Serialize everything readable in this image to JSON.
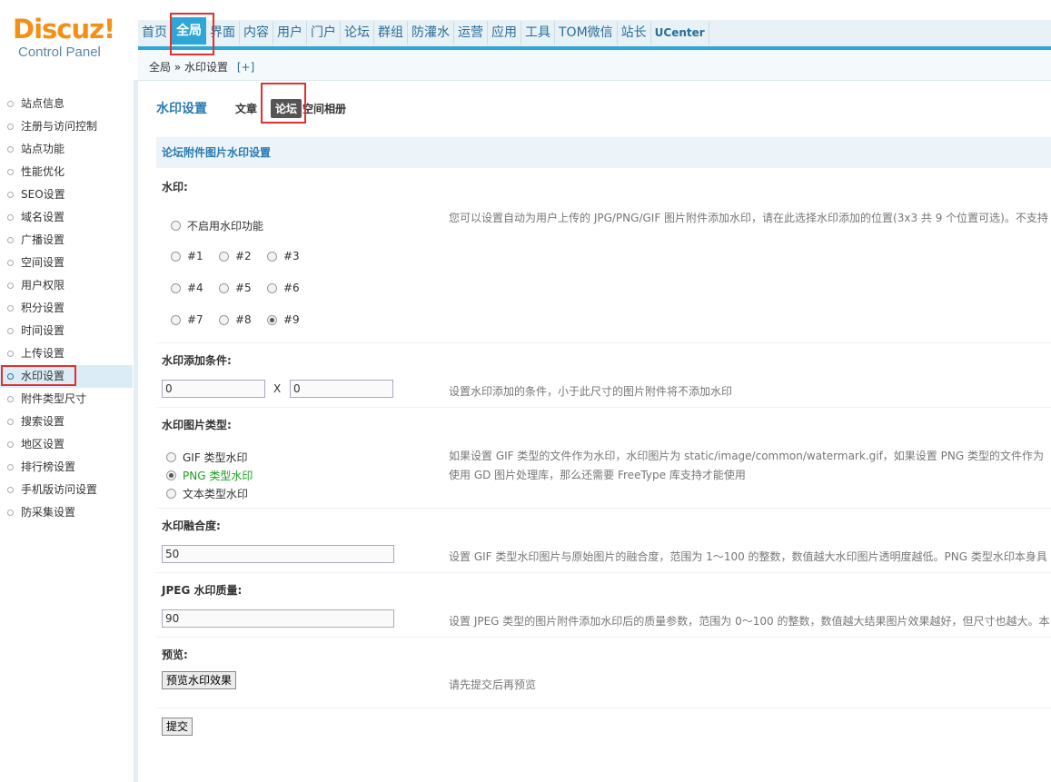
{
  "logo": {
    "brand": "Discuz!",
    "sub": "Control Panel"
  },
  "topnav": [
    "首页",
    "全局",
    "界面",
    "内容",
    "用户",
    "门户",
    "论坛",
    "群组",
    "防灌水",
    "运营",
    "应用",
    "工具",
    "TOM微信",
    "站长",
    "UCenter"
  ],
  "breadcrumb": {
    "path": "全局 » 水印设置",
    "plus": "[+]"
  },
  "sidebar": [
    "站点信息",
    "注册与访问控制",
    "站点功能",
    "性能优化",
    "SEO设置",
    "域名设置",
    "广播设置",
    "空间设置",
    "用户权限",
    "积分设置",
    "时间设置",
    "上传设置",
    "水印设置",
    "附件类型尺寸",
    "搜索设置",
    "地区设置",
    "排行榜设置",
    "手机版访问设置",
    "防采集设置"
  ],
  "subnav": {
    "title": "水印设置",
    "tabs": [
      "文章",
      "论坛",
      "空间相册"
    ]
  },
  "section": {
    "title": "论坛附件图片水印设置"
  },
  "watermark": {
    "label": "水印:",
    "disable": "不启用水印功能",
    "positions": [
      "#1",
      "#2",
      "#3",
      "#4",
      "#5",
      "#6",
      "#7",
      "#8",
      "#9"
    ],
    "hint": "您可以设置自动为用户上传的 JPG/PNG/GIF 图片附件添加水印，请在此选择水印添加的位置(3x3 共 9 个位置可选)。不支持"
  },
  "condition": {
    "label": "水印添加条件:",
    "width": "0",
    "sep": "X",
    "height": "0",
    "hint": "设置水印添加的条件，小于此尺寸的图片附件将不添加水印"
  },
  "type": {
    "label": "水印图片类型:",
    "options": [
      "GIF 类型水印",
      "PNG 类型水印",
      "文本类型水印"
    ],
    "hint1": "如果设置 GIF 类型的文件作为水印，水印图片为 static/image/common/watermark.gif，如果设置 PNG 类型的文件作为",
    "hint2": "使用 GD 图片处理库，那么还需要 FreeType 库支持才能使用"
  },
  "blend": {
    "label": "水印融合度:",
    "value": "50",
    "hint": "设置 GIF 类型水印图片与原始图片的融合度，范围为 1～100 的整数，数值越大水印图片透明度越低。PNG 类型水印本身具"
  },
  "quality": {
    "label": "JPEG 水印质量:",
    "value": "90",
    "hint": "设置 JPEG 类型的图片附件添加水印后的质量参数，范围为 0～100 的整数，数值越大结果图片效果越好，但尺寸也越大。本"
  },
  "preview": {
    "label": "预览:",
    "button": "预览水印效果",
    "hint": "请先提交后再预览"
  },
  "submit": "提交"
}
